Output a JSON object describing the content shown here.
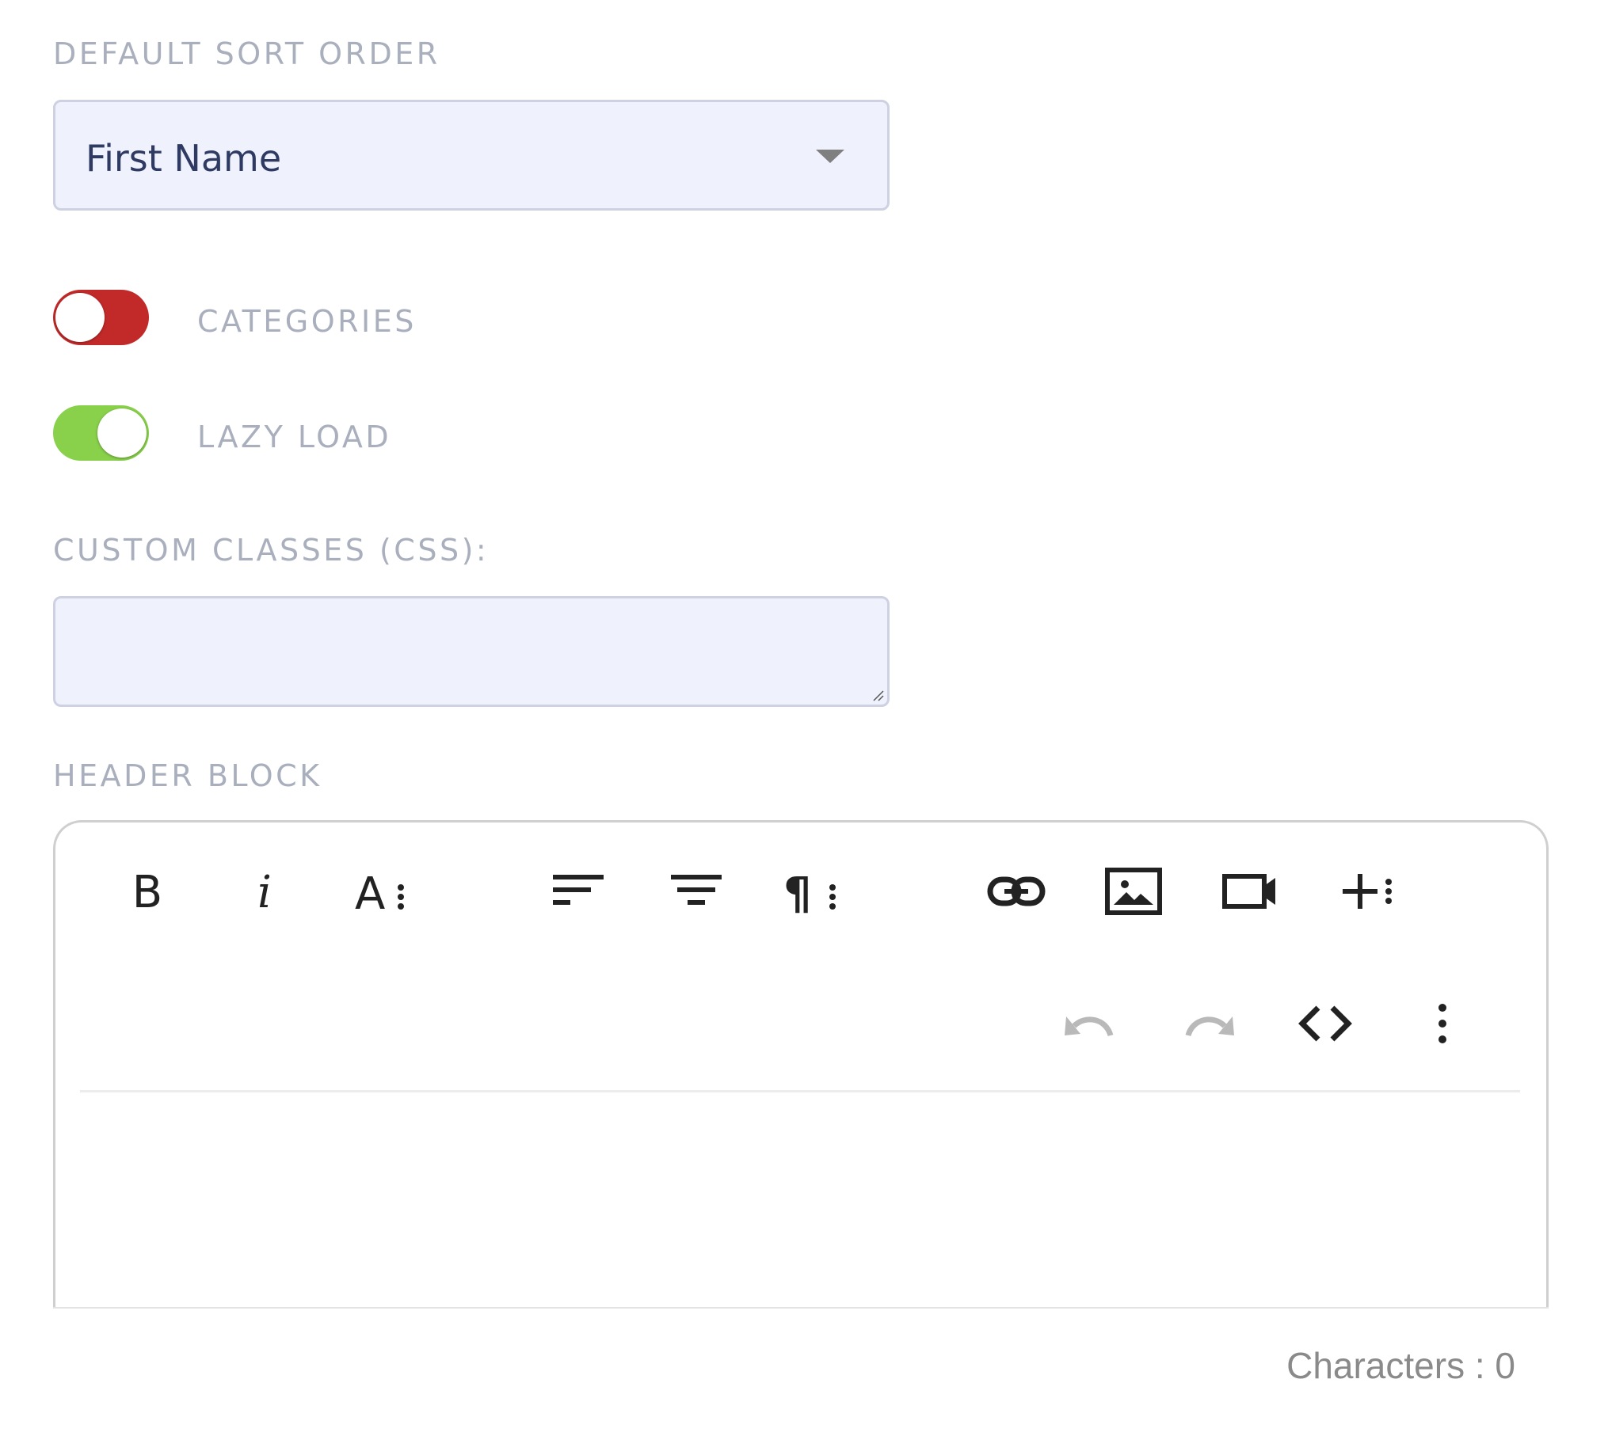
{
  "sort": {
    "label": "DEFAULT SORT ORDER",
    "selected": "First Name"
  },
  "toggles": [
    {
      "label": "CATEGORIES",
      "state": "off",
      "color": "#c22a2a"
    },
    {
      "label": "LAZY LOAD",
      "state": "on",
      "color": "#89d14b"
    }
  ],
  "custom_classes": {
    "label": "CUSTOM CLASSES (CSS):",
    "value": ""
  },
  "header_block": {
    "label": "HEADER BLOCK",
    "toolbar_row1": [
      "bold-icon",
      "italic-icon",
      "font-size-more-icon",
      "align-left-icon",
      "align-center-icon",
      "paragraph-more-icon",
      "link-icon",
      "image-icon",
      "video-icon",
      "insert-more-icon"
    ],
    "toolbar_row2": [
      "undo-icon",
      "redo-icon",
      "code-view-icon",
      "more-vertical-icon"
    ],
    "char_count": "Characters : 0"
  }
}
